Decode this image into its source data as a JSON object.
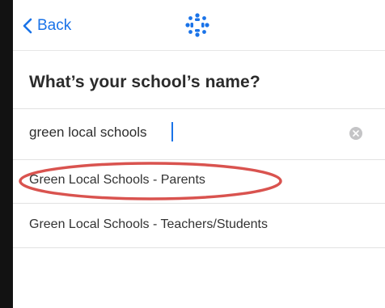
{
  "nav": {
    "back_label": "Back"
  },
  "heading": "What’s your school’s name?",
  "search": {
    "value": "green local schools",
    "placeholder": ""
  },
  "results": [
    {
      "label": "Green Local Schools - Parents"
    },
    {
      "label": "Green Local Schools - Teachers/Students"
    }
  ],
  "colors": {
    "accent": "#1a73e8",
    "annotation": "#d9534f",
    "side_bar": "#121212"
  },
  "icons": {
    "back": "chevron-left-icon",
    "logo": "canvas-logo-icon",
    "clear": "clear-x-icon"
  }
}
